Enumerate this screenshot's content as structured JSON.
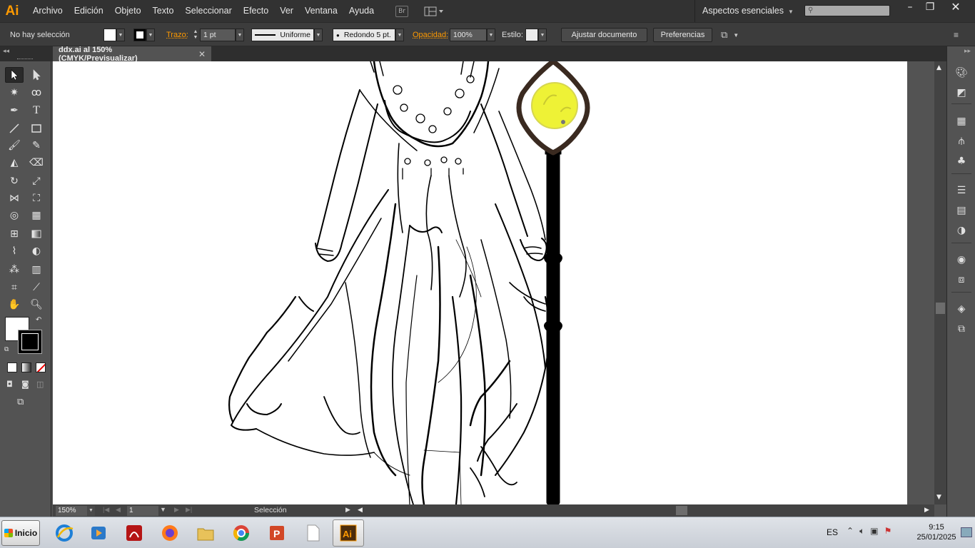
{
  "app": {
    "logo": "Ai",
    "menu": [
      "Archivo",
      "Edición",
      "Objeto",
      "Texto",
      "Seleccionar",
      "Efecto",
      "Ver",
      "Ventana",
      "Ayuda"
    ],
    "bridge_label": "Br",
    "workspace": "Aspectos esenciales"
  },
  "control_bar": {
    "selection_status": "No hay selección",
    "stroke_label": "Trazo:",
    "stroke_weight": "1 pt",
    "stroke_profile": "Uniforme",
    "brush": "Redondo 5 pt.",
    "opacity_label": "Opacidad:",
    "opacity_value": "100%",
    "style_label": "Estilo:",
    "fit_button": "Ajustar documento",
    "prefs_button": "Preferencias"
  },
  "document": {
    "tab_title": "ddx.ai al 150% (CMYK/Previsualizar)"
  },
  "status_bar": {
    "zoom": "150%",
    "page": "1",
    "tool": "Selección"
  },
  "taskbar": {
    "start": "Inicio",
    "language": "ES",
    "time": "9:15",
    "date": "25/01/2025",
    "apps": [
      "internet-explorer",
      "media-player",
      "acrobat",
      "firefox",
      "file-explorer",
      "chrome",
      "powerpoint",
      "blank-document",
      "illustrator"
    ]
  },
  "colors": {
    "accent_orange": "#ff9a00",
    "lamp_yellow": "#eef236"
  }
}
